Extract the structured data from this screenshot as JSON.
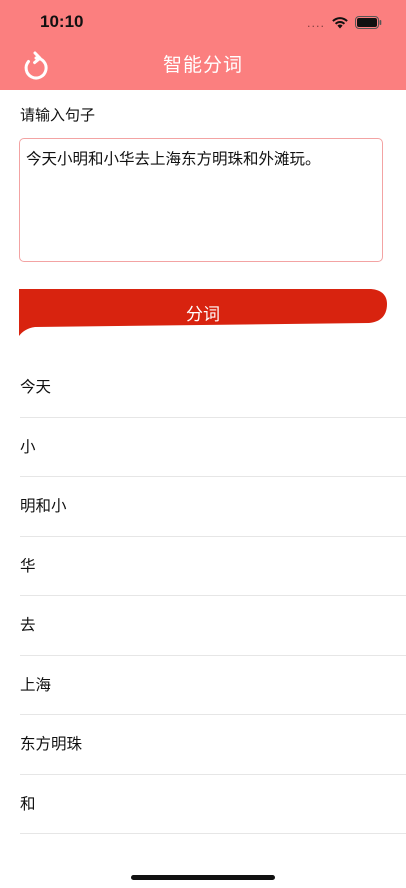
{
  "status_bar": {
    "time": "10:10",
    "signal_dots": "....",
    "icons": [
      "wifi-icon",
      "battery-icon"
    ]
  },
  "nav": {
    "title": "智能分词",
    "back_icon": "back-arrow-icon"
  },
  "form": {
    "label": "请输入句子",
    "input_value": "今天小明和小华去上海东方明珠和外滩玩。",
    "button_label": "分词"
  },
  "results": [
    "今天",
    "小",
    "明和小",
    "华",
    "去",
    "上海",
    "东方明珠",
    "和"
  ],
  "colors": {
    "header": "#fb7f7f",
    "button": "#d8230f",
    "input_border": "#f3a3a3",
    "divider": "#e6e6e6"
  }
}
